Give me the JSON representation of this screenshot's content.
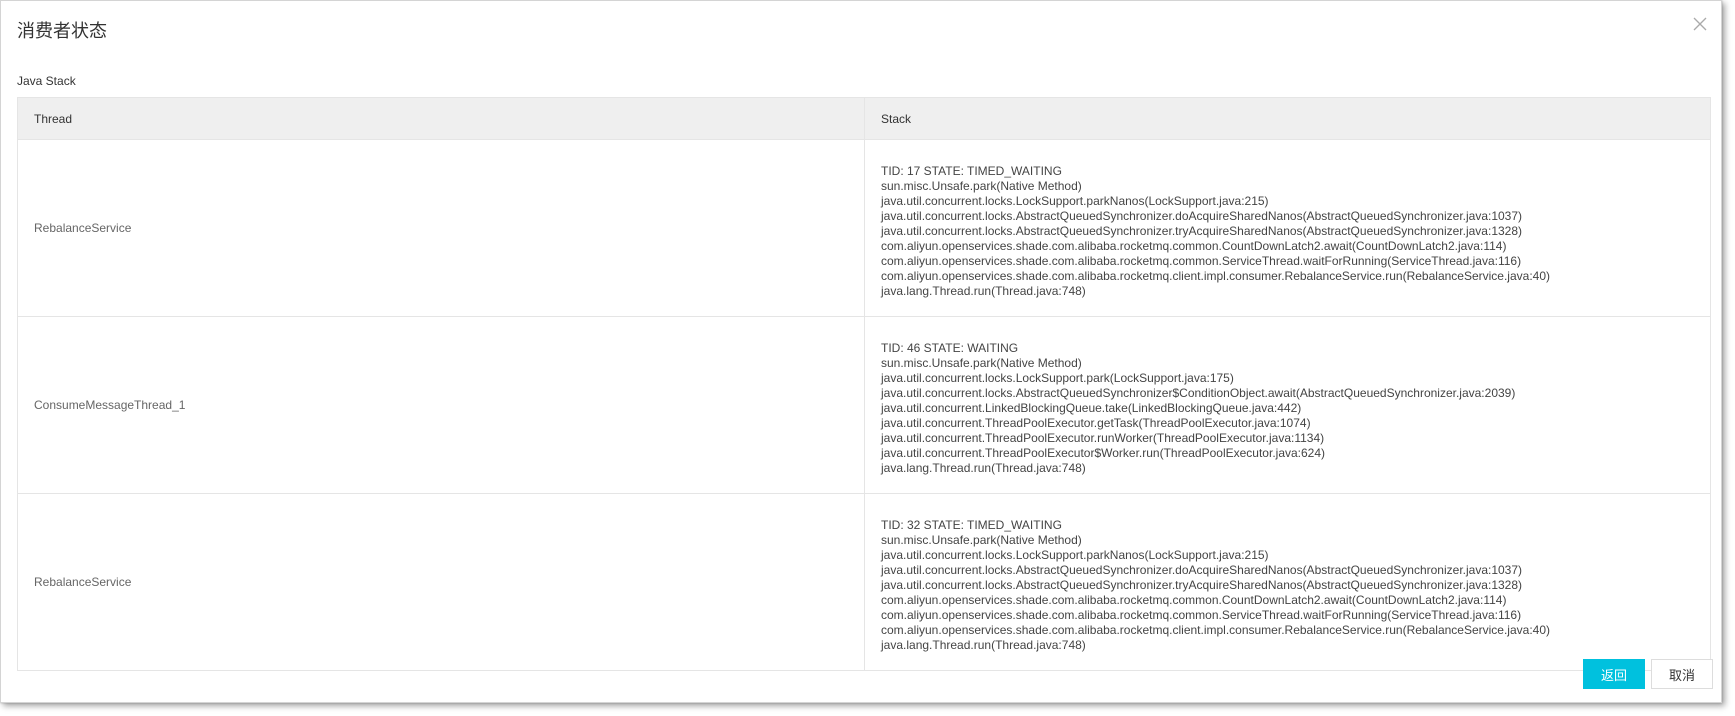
{
  "dialog": {
    "title": "消费者状态",
    "close_icon": "close-icon",
    "section_label": "Java Stack"
  },
  "table": {
    "headers": [
      "Thread",
      "Stack"
    ],
    "rows": [
      {
        "thread": "RebalanceService",
        "stack": [
          "TID: 17 STATE: TIMED_WAITING",
          "sun.misc.Unsafe.park(Native Method)",
          "java.util.concurrent.locks.LockSupport.parkNanos(LockSupport.java:215)",
          "java.util.concurrent.locks.AbstractQueuedSynchronizer.doAcquireSharedNanos(AbstractQueuedSynchronizer.java:1037)",
          "java.util.concurrent.locks.AbstractQueuedSynchronizer.tryAcquireSharedNanos(AbstractQueuedSynchronizer.java:1328)",
          "com.aliyun.openservices.shade.com.alibaba.rocketmq.common.CountDownLatch2.await(CountDownLatch2.java:114)",
          "com.aliyun.openservices.shade.com.alibaba.rocketmq.common.ServiceThread.waitForRunning(ServiceThread.java:116)",
          "com.aliyun.openservices.shade.com.alibaba.rocketmq.client.impl.consumer.RebalanceService.run(RebalanceService.java:40)",
          "java.lang.Thread.run(Thread.java:748)"
        ]
      },
      {
        "thread": "ConsumeMessageThread_1",
        "stack": [
          "TID: 46 STATE: WAITING",
          "sun.misc.Unsafe.park(Native Method)",
          "java.util.concurrent.locks.LockSupport.park(LockSupport.java:175)",
          "java.util.concurrent.locks.AbstractQueuedSynchronizer$ConditionObject.await(AbstractQueuedSynchronizer.java:2039)",
          "java.util.concurrent.LinkedBlockingQueue.take(LinkedBlockingQueue.java:442)",
          "java.util.concurrent.ThreadPoolExecutor.getTask(ThreadPoolExecutor.java:1074)",
          "java.util.concurrent.ThreadPoolExecutor.runWorker(ThreadPoolExecutor.java:1134)",
          "java.util.concurrent.ThreadPoolExecutor$Worker.run(ThreadPoolExecutor.java:624)",
          "java.lang.Thread.run(Thread.java:748)"
        ]
      },
      {
        "thread": "RebalanceService",
        "stack": [
          "TID: 32 STATE: TIMED_WAITING",
          "sun.misc.Unsafe.park(Native Method)",
          "java.util.concurrent.locks.LockSupport.parkNanos(LockSupport.java:215)",
          "java.util.concurrent.locks.AbstractQueuedSynchronizer.doAcquireSharedNanos(AbstractQueuedSynchronizer.java:1037)",
          "java.util.concurrent.locks.AbstractQueuedSynchronizer.tryAcquireSharedNanos(AbstractQueuedSynchronizer.java:1328)",
          "com.aliyun.openservices.shade.com.alibaba.rocketmq.common.CountDownLatch2.await(CountDownLatch2.java:114)",
          "com.aliyun.openservices.shade.com.alibaba.rocketmq.common.ServiceThread.waitForRunning(ServiceThread.java:116)",
          "com.aliyun.openservices.shade.com.alibaba.rocketmq.client.impl.consumer.RebalanceService.run(RebalanceService.java:40)",
          "java.lang.Thread.run(Thread.java:748)"
        ]
      }
    ]
  },
  "footer": {
    "confirm_label": "返回",
    "cancel_label": "取消"
  },
  "colors": {
    "primary": "#00c1de",
    "header_bg": "#efefef",
    "border": "#e5e5e5"
  }
}
